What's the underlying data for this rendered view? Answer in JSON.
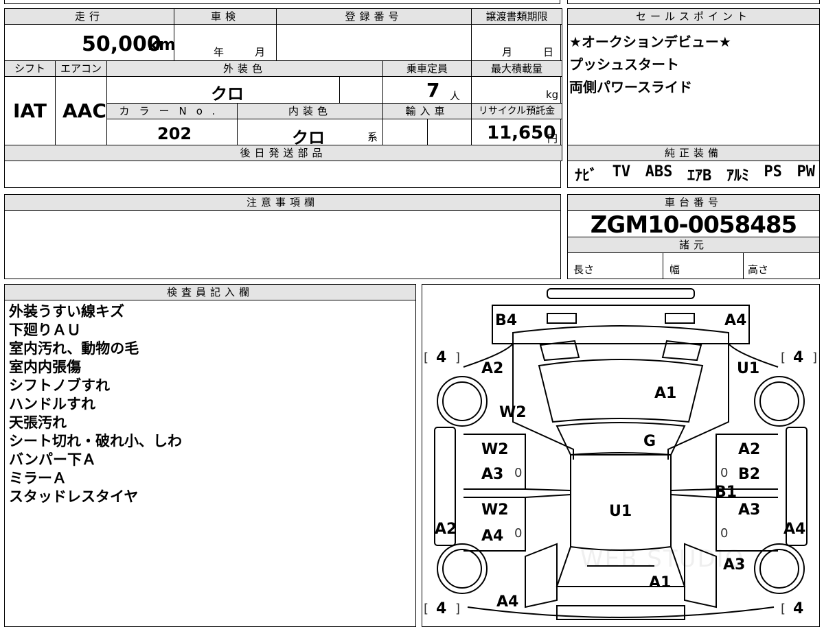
{
  "vehicle": {
    "mileage_label": "走行",
    "mileage_value": "50,000",
    "mileage_unit": "km",
    "inspection_label": "車検",
    "inspection_year_unit": "年",
    "inspection_month_unit": "月",
    "registration_label": "登録番号",
    "transfer_deadline_label": "譲渡書類期限",
    "transfer_month_unit": "月",
    "transfer_day_unit": "日",
    "shift_label": "シフト",
    "shift_value": "IAT",
    "aircon_label": "エアコン",
    "aircon_value": "AAC",
    "exterior_color_label": "外装色",
    "exterior_color_value": "クロ",
    "capacity_label": "乗車定員",
    "capacity_value": "7",
    "capacity_unit": "人",
    "max_load_label": "最大積載量",
    "max_load_unit": "kg",
    "color_no_label": "カラーNo.",
    "color_no_value": "202",
    "interior_color_label": "内装色",
    "interior_color_value": "クロ",
    "interior_color_suffix": "系",
    "import_label": "輸入車",
    "recycle_label": "リサイクル預託金",
    "recycle_value": "11,650",
    "recycle_unit": "円",
    "later_parts_label": "後日発送部品"
  },
  "sales_points": {
    "label": "セールスポイント",
    "lines": [
      "★オークションデビュー★",
      "プッシュスタート",
      "両側パワースライド"
    ]
  },
  "genuine_equipment": {
    "label": "純正装備",
    "items": [
      "ﾅﾋﾞ",
      "TV",
      "ABS",
      "ｴｱB",
      "ｱﾙﾐ",
      "PS",
      "PW"
    ]
  },
  "notes": {
    "label": "注意事項欄"
  },
  "chassis": {
    "label": "車台番号",
    "value": "ZGM10-0058485",
    "specs_label": "諸元",
    "length_label": "長さ",
    "width_label": "幅",
    "height_label": "高さ"
  },
  "inspector": {
    "label": "検査員記入欄",
    "lines": [
      "外装うすい線キズ",
      "下廻りＡＵ",
      "室内汚れ、動物の毛",
      "室内内張傷",
      "シフトノブすれ",
      "ハンドルすれ",
      "天張汚れ",
      "シート切れ・破れ小、しわ",
      "バンパー下Ａ",
      "ミラーＡ",
      "スタッドレスタイヤ"
    ]
  },
  "diagram": {
    "labels": {
      "b4": "B4",
      "a4_top": "A4",
      "a2_tl": "A2",
      "u1_tr": "U1",
      "a1_top": "A1",
      "w2_l": "W2",
      "g": "G",
      "w2_door_fl": "W2",
      "a3_door_fl": "A3",
      "a2_door_fr": "A2",
      "b2_door_fr": "B2",
      "b1_door_fr": "B1",
      "w2_door_rl": "W2",
      "a4_door_rl": "A4",
      "a3_door_rr": "A3",
      "u1_center": "U1",
      "a2_left": "A2",
      "a4_right": "A4",
      "a3_rear_r": "A3",
      "a1_rear": "A1",
      "a4_bottom": "A4"
    },
    "tire_tl": "4",
    "tire_tr": "4",
    "tire_bl": "4",
    "tire_br": "4",
    "zero": "0",
    "watermark": "WEB STUDIO"
  }
}
